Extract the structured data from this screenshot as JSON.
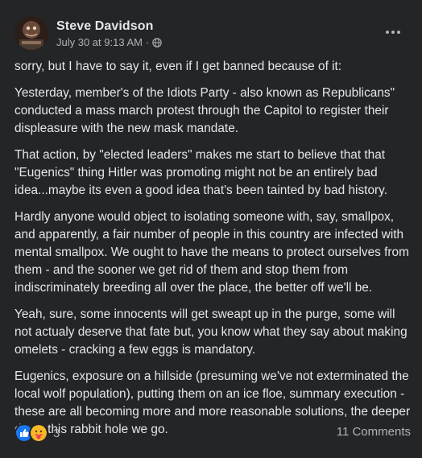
{
  "post": {
    "author": "Steve Davidson",
    "timestamp": "July 30 at 9:13 AM",
    "separator": "·",
    "privacy_icon": "globe-icon",
    "more_icon": "more-options-icon",
    "paragraphs": [
      "sorry, but I have to say it, even if I get banned because of it:",
      "Yesterday, member's of the Idiots Party - also known as Republicans\" conducted a mass march protest through the Capitol to register their displeasure with the new mask mandate.",
      "That action, by \"elected leaders\" makes me start to believe that that \"Eugenics\" thing Hitler was promoting might not be an entirely bad idea...maybe its even a good idea that's been tainted by bad history.",
      "Hardly anyone would object to isolating someone with, say, smallpox, and apparently, a fair number of people in this country are infected with mental smallpox.  We ought to have the means to protect ourselves from them - and the sooner we get rid of them and stop them from indiscriminately breeding all over the place, the better off we'll be.",
      "Yeah, sure, some innocents will get sweapt up in the purge, some will not actualy deserve that fate but, you know what they say about making omelets - cracking a few eggs is mandatory.",
      "Eugenics, exposure on a hillside (presuming we've not exterminated the local wolf population), putting them on an ice floe, summary execution - these are all becoming more and more reasonable solutions, the deeper down this rabbit hole we go."
    ]
  },
  "footer": {
    "reaction_icons": [
      "like-icon",
      "care-icon"
    ],
    "reaction_count": "3",
    "comments": "11 Comments"
  },
  "colors": {
    "background": "#242526",
    "text_primary": "#e4e6eb",
    "text_secondary": "#b0b3b8",
    "like_blue": "#1877f2",
    "care_yellow": "#f7b928"
  }
}
